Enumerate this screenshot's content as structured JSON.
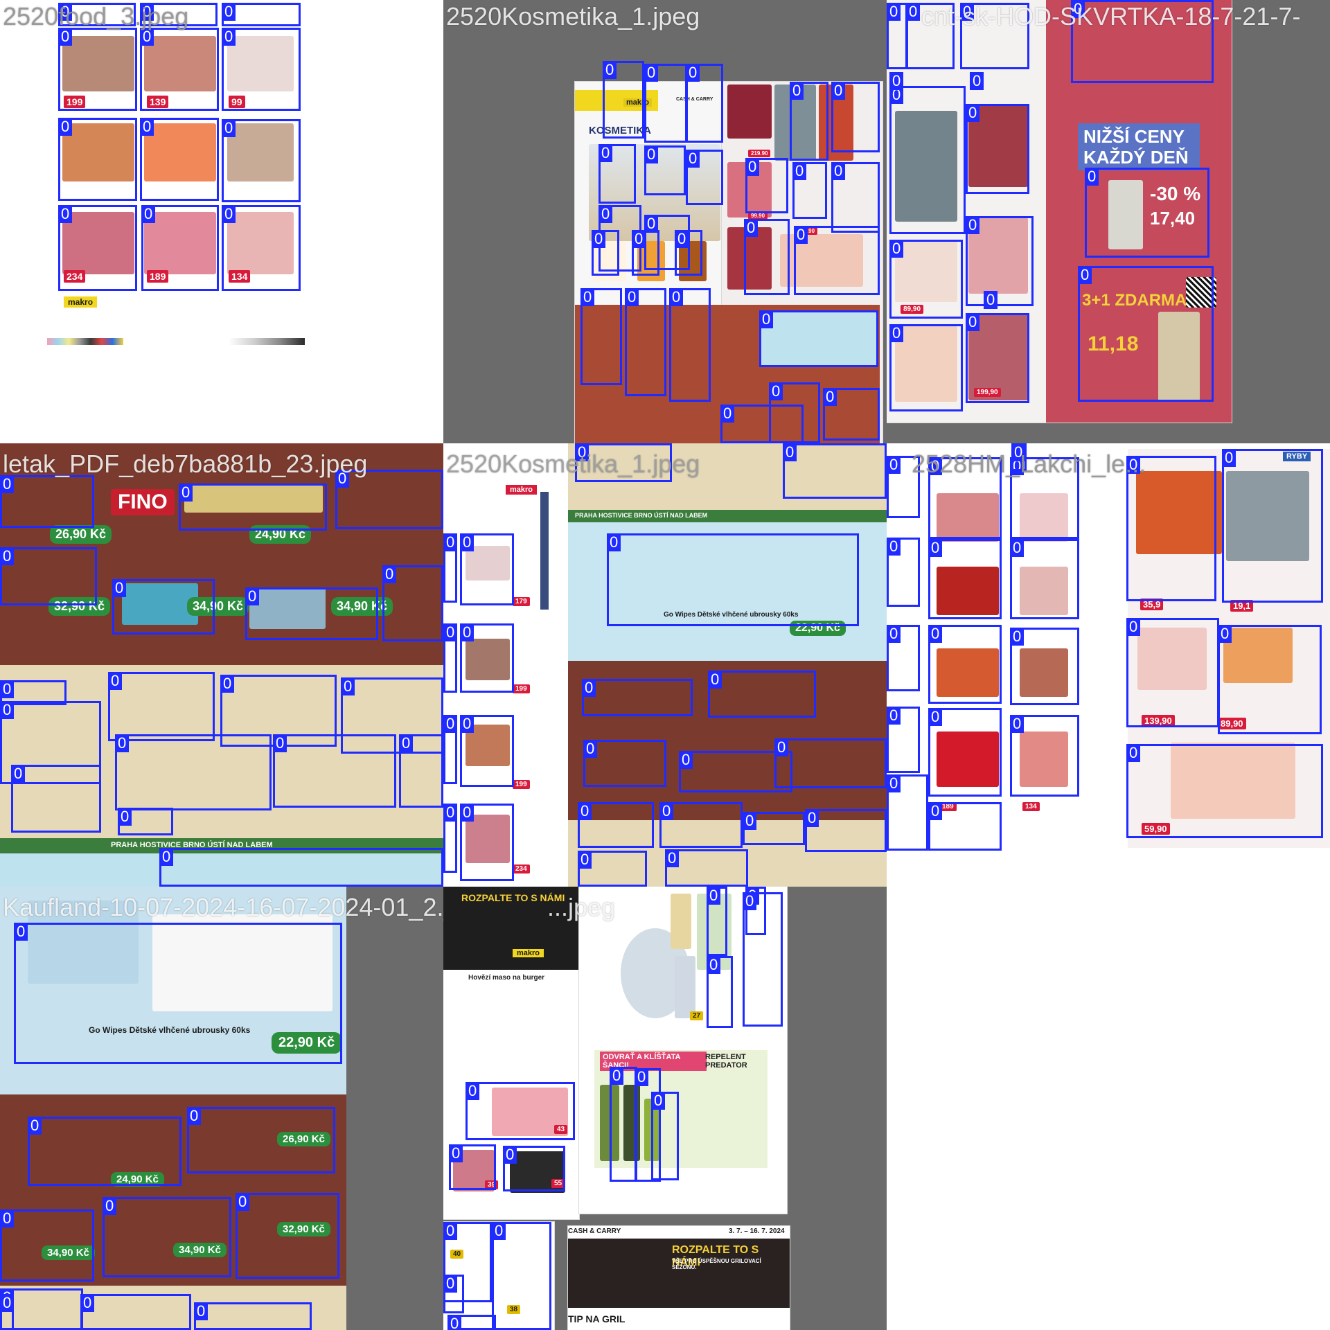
{
  "grid": {
    "tiles": [
      {
        "label": "2520food_3.jpeg",
        "background": "#ffffff",
        "detections": [
          {
            "class": "0"
          },
          {
            "class": "0"
          },
          {
            "class": "0"
          },
          {
            "class": "0"
          },
          {
            "class": "0"
          },
          {
            "class": "0"
          },
          {
            "class": "0"
          },
          {
            "class": "0"
          },
          {
            "class": "0"
          },
          {
            "class": "0"
          },
          {
            "class": "0"
          },
          {
            "class": "0"
          }
        ],
        "texts": {
          "logo": "makro",
          "price_1": "199",
          "price_2": "139",
          "price_3": "99",
          "price_4": "234",
          "price_5": "189",
          "price_6": "134"
        }
      },
      {
        "label": "2520Kosmetika_1.jpeg",
        "background": "#6b6b6b",
        "detections": [
          {
            "class": "0"
          },
          {
            "class": "0"
          },
          {
            "class": "0"
          },
          {
            "class": "0"
          },
          {
            "class": "0"
          },
          {
            "class": "0"
          },
          {
            "class": "0"
          },
          {
            "class": "0"
          },
          {
            "class": "0"
          },
          {
            "class": "0"
          },
          {
            "class": "0"
          },
          {
            "class": "0"
          },
          {
            "class": "0"
          },
          {
            "class": "0"
          },
          {
            "class": "0"
          },
          {
            "class": "0"
          },
          {
            "class": "0"
          },
          {
            "class": "0"
          },
          {
            "class": "0"
          },
          {
            "class": "0"
          },
          {
            "class": "0"
          },
          {
            "class": "0"
          },
          {
            "class": "0"
          },
          {
            "class": "0"
          },
          {
            "class": "0"
          }
        ],
        "texts": {
          "logo": "makro",
          "title": "KOSMETIKA",
          "subtitle": "CASH & CARRY",
          "price_1": "219.90",
          "price_2": "89.90",
          "price_3": "99.90"
        }
      },
      {
        "label": "cnt-sk-HOD-SKVRTKA-18-7-21-7-",
        "background": "#6b6b6b",
        "detections": [
          {
            "class": "0"
          },
          {
            "class": "0"
          },
          {
            "class": "0"
          },
          {
            "class": "0"
          },
          {
            "class": "0"
          },
          {
            "class": "0"
          },
          {
            "class": "0"
          },
          {
            "class": "0"
          },
          {
            "class": "0"
          },
          {
            "class": "0"
          },
          {
            "class": "0"
          },
          {
            "class": "0"
          },
          {
            "class": "0"
          },
          {
            "class": "0"
          },
          {
            "class": "0"
          }
        ],
        "texts": {
          "banner": "NIŽŠÍ CENY KAŽDÝ DEŇ",
          "promo_1": "-30 %",
          "promo_2": "17,40",
          "promo_3": "3+1 ZDARMA",
          "promo_4": "11,18",
          "price_1": "199,90",
          "price_2": "89,90"
        }
      },
      {
        "label": "letak_PDF_deb7ba881b_23.jpeg",
        "background": "#7a3b2e",
        "detections": [
          {
            "class": "0"
          },
          {
            "class": "0"
          },
          {
            "class": "0"
          },
          {
            "class": "0"
          },
          {
            "class": "0"
          },
          {
            "class": "0"
          },
          {
            "class": "0"
          },
          {
            "class": "0"
          },
          {
            "class": "0"
          },
          {
            "class": "0"
          },
          {
            "class": "0"
          },
          {
            "class": "0"
          },
          {
            "class": "0"
          },
          {
            "class": "0"
          },
          {
            "class": "0"
          },
          {
            "class": "0"
          },
          {
            "class": "0"
          },
          {
            "class": "0"
          }
        ],
        "texts": {
          "brand": "FINO",
          "footer": "PRAHA  HOSTIVICE  BRNO  ÚSTÍ NAD LABEM",
          "price_1": "26,90 Kč",
          "price_2": "24,90 Kč",
          "price_3": "32,90 Kč",
          "price_4": "34,90 Kč",
          "price_5": "34,90 Kč"
        }
      },
      {
        "label": "2520Kosmetika_1.jpeg",
        "background": "#ffffff",
        "detections": [
          {
            "class": "0"
          },
          {
            "class": "0"
          },
          {
            "class": "0"
          },
          {
            "class": "0"
          },
          {
            "class": "0"
          },
          {
            "class": "0"
          },
          {
            "class": "0"
          },
          {
            "class": "0"
          },
          {
            "class": "0"
          },
          {
            "class": "0"
          },
          {
            "class": "0"
          },
          {
            "class": "0"
          },
          {
            "class": "0"
          },
          {
            "class": "0"
          },
          {
            "class": "0"
          },
          {
            "class": "0"
          },
          {
            "class": "0"
          },
          {
            "class": "0"
          },
          {
            "class": "0"
          },
          {
            "class": "0"
          },
          {
            "class": "0"
          },
          {
            "class": "0"
          }
        ],
        "texts": {
          "logo": "makro",
          "product": "Go Wipes Dětské vlhčené ubrousky 60ks",
          "price_1": "22,90 Kč",
          "footer": "PRAHA  HOSTIVICE  BRNO  ÚSTÍ NAD LABEM",
          "side_price_1": "179",
          "side_price_2": "199",
          "side_price_3": "199",
          "side_price_4": "234"
        }
      },
      {
        "label": "2528HM_Lakchi_le...",
        "background": "#ffffff",
        "detections": [
          {
            "class": "0"
          },
          {
            "class": "0"
          },
          {
            "class": "0"
          },
          {
            "class": "0"
          },
          {
            "class": "0"
          },
          {
            "class": "0"
          },
          {
            "class": "0"
          },
          {
            "class": "0"
          },
          {
            "class": "0"
          },
          {
            "class": "0"
          },
          {
            "class": "0"
          },
          {
            "class": "0"
          },
          {
            "class": "0"
          },
          {
            "class": "0"
          },
          {
            "class": "0"
          },
          {
            "class": "0"
          },
          {
            "class": "0"
          },
          {
            "class": "0"
          },
          {
            "class": "0"
          },
          {
            "class": "0"
          }
        ],
        "texts": {
          "price_1": "35,9",
          "price_2": "19,1",
          "price_3": "139,90",
          "price_4": "89,90",
          "price_5": "59,90",
          "price_6": "189",
          "price_7": "134",
          "label": "RYBY"
        }
      },
      {
        "label": "Kaufland-10-07-2024-16-07-2024-01_2.jpeg",
        "background": "#6b6b6b",
        "detections": [
          {
            "class": "0"
          },
          {
            "class": "0"
          },
          {
            "class": "0"
          },
          {
            "class": "0"
          },
          {
            "class": "0"
          },
          {
            "class": "0"
          },
          {
            "class": "0"
          },
          {
            "class": "0"
          },
          {
            "class": "0"
          },
          {
            "class": "0"
          }
        ],
        "texts": {
          "product": "Go Wipes Dětské vlhčené ubrousky 60ks",
          "price_1": "22,90 Kč",
          "price_2": "24,90 Kč",
          "price_3": "26,90 Kč",
          "price_4": "34,90 Kč",
          "price_5": "34,90 Kč",
          "price_6": "32,90 Kč"
        }
      },
      {
        "label": "...jpeg",
        "background": "#ffffff",
        "detections": [
          {
            "class": "0"
          },
          {
            "class": "0"
          },
          {
            "class": "0"
          },
          {
            "class": "0"
          },
          {
            "class": "0"
          },
          {
            "class": "0"
          },
          {
            "class": "0"
          },
          {
            "class": "0"
          },
          {
            "class": "0"
          },
          {
            "class": "0"
          },
          {
            "class": "0"
          },
          {
            "class": "0"
          },
          {
            "class": "0"
          },
          {
            "class": "0"
          }
        ],
        "texts": {
          "banner": "ROZPALTE TO S NÁMI",
          "subbanner": "VŠE PRO ÚSPĚŠNOU GRILOVACÍ SEZÓNU.",
          "logo": "makro",
          "headline": "Hovězí maso na burger",
          "promo": "ODVRAŤ A KLÍŠŤATA ŠANCI!",
          "predator": "REPELENT PREDATOR",
          "cash": "CASH & CARRY",
          "dates": "3. 7. – 16. 7. 2024",
          "tip": "TIP NA GRIL",
          "price_1": "43",
          "price_2": "39",
          "price_3": "55",
          "price_4": "40",
          "price_5": "38",
          "price_6": "27"
        }
      }
    ]
  }
}
